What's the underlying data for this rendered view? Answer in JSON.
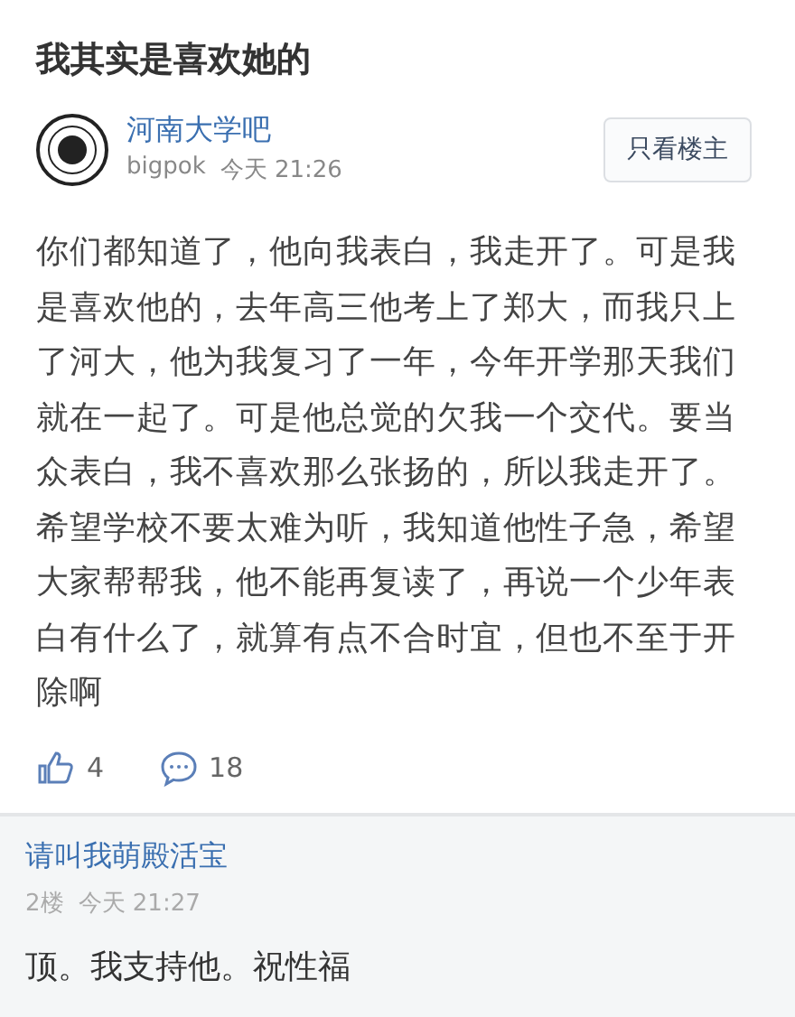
{
  "post": {
    "title": "我其实是喜欢她的",
    "forum": "河南大学吧",
    "author": "bigpok",
    "time": "今天 21:26",
    "only_op_button": "只看楼主",
    "body": "你们都知道了，他向我表白，我走开了。可是我是喜欢他的，去年高三他考上了郑大，而我只上了河大，他为我复习了一年，今年开学那天我们就在一起了。可是他总觉的欠我一个交代。要当众表白，我不喜欢那么张扬的，所以我走开了。希望学校不要太难为听，我知道他性子急，希望大家帮帮我，他不能再复读了，再说一个少年表白有什么了，就算有点不合时宜，但也不至于开除啊",
    "likes": "4",
    "comments": "18"
  },
  "reply": {
    "user": "请叫我萌殿活宝",
    "floor": "2楼",
    "time": "今天 21:27",
    "text": "顶。我支持他。祝性福"
  }
}
